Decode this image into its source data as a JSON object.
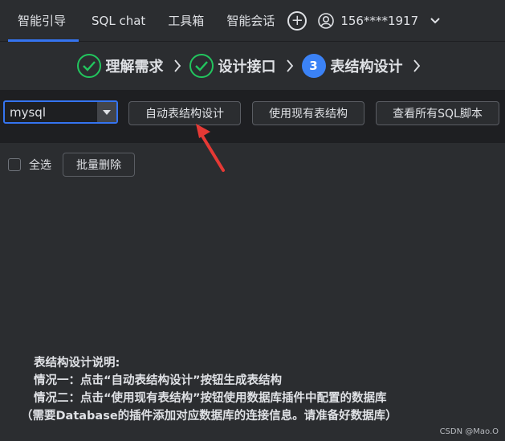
{
  "nav": {
    "tabs": [
      {
        "label": "智能引导",
        "active": true
      },
      {
        "label": "SQL chat",
        "active": false
      },
      {
        "label": "工具箱",
        "active": false
      },
      {
        "label": "智能会话",
        "active": false
      }
    ],
    "add_icon": "plus-circle-icon",
    "user": {
      "icon": "user-circle-icon",
      "name": "156****1917",
      "menu_icon": "chevron-down-icon"
    }
  },
  "steps": [
    {
      "label": "理解需求",
      "status": "done",
      "icon": "check-icon"
    },
    {
      "label": "设计接口",
      "status": "done",
      "icon": "check-icon"
    },
    {
      "label": "表结构设计",
      "status": "current",
      "number": "3"
    }
  ],
  "toolbar": {
    "db_select": {
      "value": "mysql"
    },
    "auto_design_button": "自动表结构设计",
    "use_existing_button": "使用现有表结构",
    "view_sql_button": "查看所有SQL脚本"
  },
  "list_actions": {
    "select_all_label": "全选",
    "batch_delete_button": "批量删除"
  },
  "instructions": {
    "title": "表结构设计说明:",
    "line1": "情况一：点击“自动表结构设计”按钮生成表结构",
    "line2": "情况二：点击“使用现有表结构”按钮使用数据库插件中配置的数据库",
    "line3": "（需要Database的插件添加对应数据库的连接信息。请准备好数据库）"
  },
  "watermark": "CSDN @Mao.O",
  "colors": {
    "accent": "#3574f0",
    "success": "#22c55e",
    "step_current": "#3b82f6",
    "annotation": "#e53935"
  }
}
